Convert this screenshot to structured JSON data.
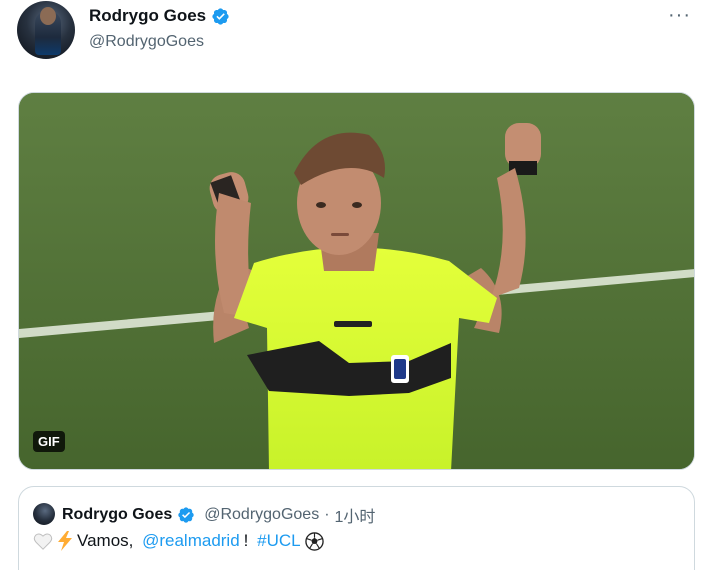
{
  "tweet": {
    "author_name": "Rodrygo Goes",
    "handle": "@RodrygoGoes",
    "more_label": "···",
    "verified_icon": "verified-badge-icon",
    "media": {
      "type_badge": "GIF"
    }
  },
  "quoted_tweet": {
    "author_name": "Rodrygo Goes",
    "handle": "@RodrygoGoes",
    "separator": "·",
    "time": "1小时",
    "text_pre": "Vamos, ",
    "mention": "@realmadrid",
    "text_mid": "! ",
    "hashtag": "#UCL",
    "emojis": [
      "white-heart-icon",
      "lightning-icon",
      "soccer-ball-icon"
    ]
  },
  "colors": {
    "accent": "#1d9bf0",
    "secondary_text": "#536471",
    "border": "#cfd9de"
  }
}
